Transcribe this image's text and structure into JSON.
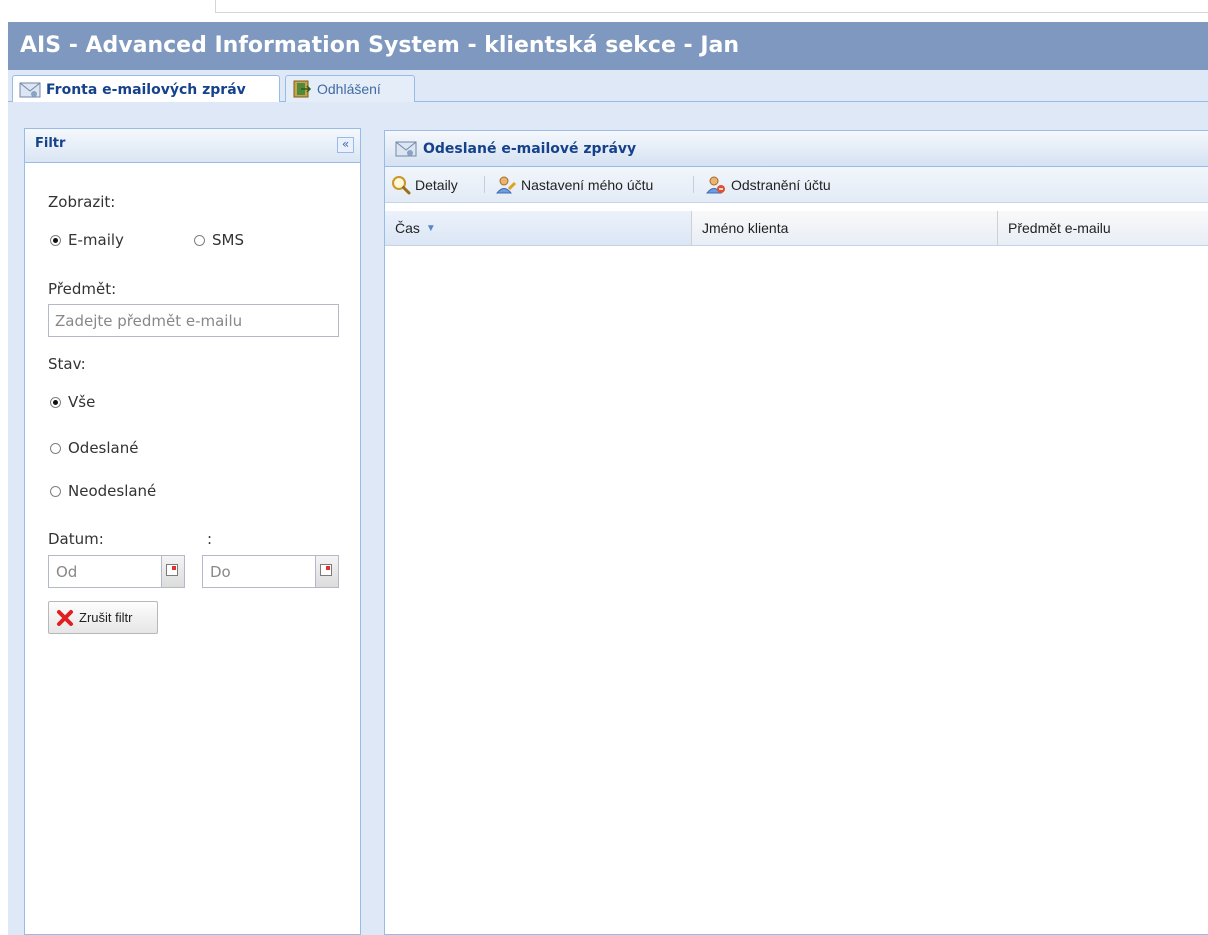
{
  "app": {
    "title": "AIS - Advanced Information System - klientská sekce - Jan"
  },
  "tabs": [
    {
      "label": "Fronta e-mailových zpráv",
      "active": true,
      "icon": "envelope-icon"
    },
    {
      "label": "Odhlášení",
      "active": false,
      "icon": "logout-door-icon"
    }
  ],
  "filter": {
    "title": "Filtr",
    "collapse_glyph": "«",
    "show_label": "Zobrazit:",
    "show_options": [
      {
        "label": "E-maily",
        "checked": true
      },
      {
        "label": "SMS",
        "checked": false
      }
    ],
    "subject_label": "Předmět:",
    "subject_placeholder": "Zadejte předmět e-mailu",
    "subject_value": "",
    "status_label": "Stav:",
    "status_options": [
      {
        "label": "Vše",
        "checked": true
      },
      {
        "label": "Odeslané",
        "checked": false
      },
      {
        "label": "Neodeslané",
        "checked": false
      }
    ],
    "date_label": "Datum:",
    "date_sep": ":",
    "date_from_placeholder": "Od",
    "date_to_placeholder": "Do",
    "clear_button": "Zrušit filtr"
  },
  "grid": {
    "title": "Odeslané e-mailové zprávy",
    "toolbar": {
      "details": "Detaily",
      "account_settings": "Nastavení mého účtu",
      "remove_account": "Odstranění účtu"
    },
    "columns": [
      {
        "label": "Čas",
        "sorted": "desc"
      },
      {
        "label": "Jméno klienta"
      },
      {
        "label": "Předmět e-mailu"
      }
    ],
    "rows": []
  },
  "colors": {
    "title_bar": "#7e98bf",
    "panel_border": "#99bbe8",
    "panel_title_text": "#15428b",
    "background": "#dfe8f6"
  }
}
